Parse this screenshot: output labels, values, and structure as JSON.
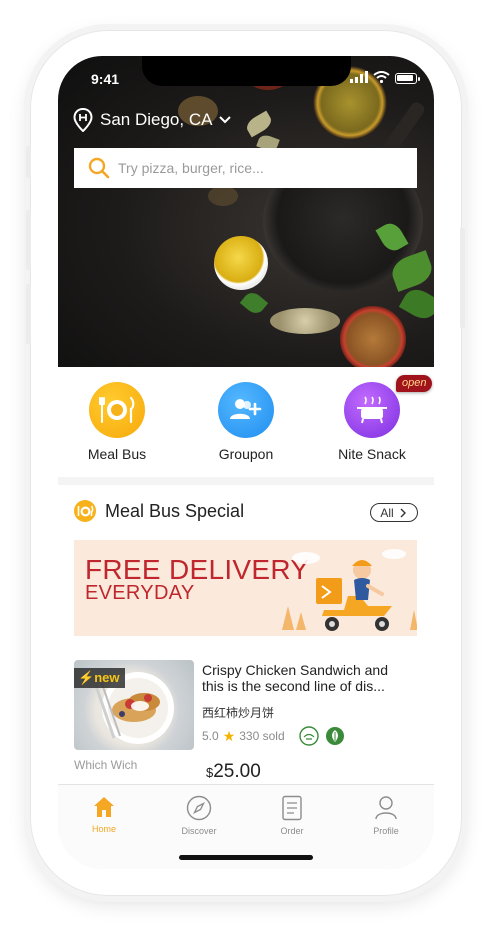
{
  "status_bar": {
    "time": "9:41"
  },
  "location": {
    "city": "San Diego, CA"
  },
  "search": {
    "placeholder": "Try pizza, burger, rice..."
  },
  "categories": [
    {
      "label": "Meal Bus"
    },
    {
      "label": "Groupon"
    },
    {
      "label": "Nite Snack",
      "badge": "open"
    }
  ],
  "section": {
    "title": "Meal Bus Special",
    "all_label": "All"
  },
  "banner": {
    "line1": "FREE DELIVERY",
    "line2": "EVERYDAY"
  },
  "item": {
    "badge": "new",
    "title": "Crispy Chicken Sandwich and this is the second line of dis...",
    "subtitle": "西红柿炒月饼",
    "rating": "5.0",
    "sold": "330 sold",
    "currency": "$",
    "price": "25.00",
    "store": "Which Wich"
  },
  "tabs": [
    {
      "label": "Home",
      "icon": "home-icon",
      "active": true
    },
    {
      "label": "Discover",
      "icon": "compass-icon",
      "active": false
    },
    {
      "label": "Order",
      "icon": "document-icon",
      "active": false
    },
    {
      "label": "Profile",
      "icon": "user-icon",
      "active": false
    }
  ],
  "colors": {
    "accent": "#f5a623",
    "banner_text": "#c0262d",
    "badge_bg": "#a0131c",
    "halal_green": "#3a8a3a"
  }
}
